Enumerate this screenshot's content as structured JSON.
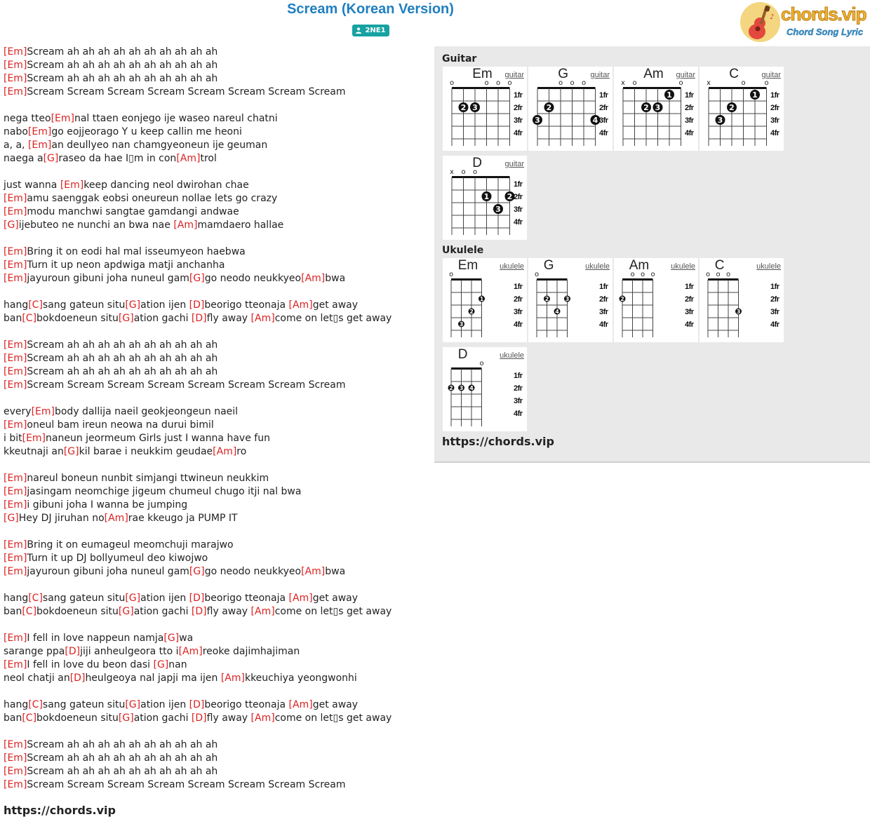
{
  "song": {
    "title": "Scream (Korean Version)",
    "artist": "2NE1"
  },
  "logo": {
    "wordmark": "chords.vip",
    "tagline": "Chord Song Lyric",
    "icon": "ukulele-icon"
  },
  "colors": {
    "title": "#1f7fc1",
    "chord": "#dd2222",
    "artist_badge": "#17a2a2"
  },
  "lyrics": [
    [
      [
        "Em",
        ""
      ],
      [
        "",
        "Scream ah ah ah ah ah ah ah ah ah ah"
      ]
    ],
    [
      [
        "Em",
        ""
      ],
      [
        "",
        "Scream ah ah ah ah ah ah ah ah ah ah"
      ]
    ],
    [
      [
        "Em",
        ""
      ],
      [
        "",
        "Scream ah ah ah ah ah ah ah ah ah ah"
      ]
    ],
    [
      [
        "Em",
        ""
      ],
      [
        "",
        "Scream Scream Scream Scream Scream Scream Scream Scream"
      ]
    ],
    [],
    [
      [
        "",
        "nega tteo"
      ],
      [
        "Em",
        ""
      ],
      [
        "",
        "nal ttaen eonjego ije waseo nareul chatni"
      ]
    ],
    [
      [
        "",
        "nabo"
      ],
      [
        "Em",
        ""
      ],
      [
        "",
        "go eojjeorago Y u keep callin me heoni"
      ]
    ],
    [
      [
        "",
        "a, a, "
      ],
      [
        "Em",
        ""
      ],
      [
        "",
        "an deullyeo nan chamgyeoneun ije geuman"
      ]
    ],
    [
      [
        "",
        "naega a"
      ],
      [
        "G",
        ""
      ],
      [
        "",
        "raseo da hae I▯m in con"
      ],
      [
        "Am",
        ""
      ],
      [
        "",
        "trol"
      ]
    ],
    [],
    [
      [
        "",
        "just wanna "
      ],
      [
        "Em",
        ""
      ],
      [
        "",
        "keep dancing neol dwirohan chae"
      ]
    ],
    [
      [
        "Em",
        ""
      ],
      [
        "",
        "amu saenggak eobsi oneureun nollae lets go crazy"
      ]
    ],
    [
      [
        "Em",
        ""
      ],
      [
        "",
        "modu manchwi sangtae gamdangi andwae"
      ]
    ],
    [
      [
        "G",
        ""
      ],
      [
        "",
        "ijebuteo ne nunchi an bwa nae "
      ],
      [
        "Am",
        ""
      ],
      [
        "",
        "mamdaero hallae"
      ]
    ],
    [],
    [
      [
        "Em",
        ""
      ],
      [
        "",
        "Bring it on eodi hal mal isseumyeon haebwa"
      ]
    ],
    [
      [
        "Em",
        ""
      ],
      [
        "",
        "Turn it up neon apdwiga matji anchanha"
      ]
    ],
    [
      [
        "Em",
        ""
      ],
      [
        "",
        "jayuroun gibuni joha nuneul gam"
      ],
      [
        "G",
        ""
      ],
      [
        "",
        "go neodo neukkyeo"
      ],
      [
        "Am",
        ""
      ],
      [
        "",
        "bwa"
      ]
    ],
    [],
    [
      [
        "",
        "hang"
      ],
      [
        "C",
        ""
      ],
      [
        "",
        "sang gateun situ"
      ],
      [
        "G",
        ""
      ],
      [
        "",
        "ation ijen "
      ],
      [
        "D",
        ""
      ],
      [
        "",
        "beorigo tteonaja "
      ],
      [
        "Am",
        ""
      ],
      [
        "",
        "get away"
      ]
    ],
    [
      [
        "",
        "ban"
      ],
      [
        "C",
        ""
      ],
      [
        "",
        "bokdoeneun situ"
      ],
      [
        "G",
        ""
      ],
      [
        "",
        "ation gachi "
      ],
      [
        "D",
        ""
      ],
      [
        "",
        "fly away "
      ],
      [
        "Am",
        ""
      ],
      [
        "",
        "come on let▯s get away"
      ]
    ],
    [],
    [
      [
        "Em",
        ""
      ],
      [
        "",
        "Scream ah ah ah ah ah ah ah ah ah ah"
      ]
    ],
    [
      [
        "Em",
        ""
      ],
      [
        "",
        "Scream ah ah ah ah ah ah ah ah ah ah"
      ]
    ],
    [
      [
        "Em",
        ""
      ],
      [
        "",
        "Scream ah ah ah ah ah ah ah ah ah ah"
      ]
    ],
    [
      [
        "Em",
        ""
      ],
      [
        "",
        "Scream Scream Scream Scream Scream Scream Scream Scream"
      ]
    ],
    [],
    [
      [
        "",
        "every"
      ],
      [
        "Em",
        ""
      ],
      [
        "",
        "body dallija naeil geokjeongeun naeil"
      ]
    ],
    [
      [
        "Em",
        ""
      ],
      [
        "",
        "oneul bam ireun neowa na durui bimil"
      ]
    ],
    [
      [
        "",
        "i bit"
      ],
      [
        "Em",
        ""
      ],
      [
        "",
        "naneun jeormeum Girls just I wanna have fun"
      ]
    ],
    [
      [
        "",
        "kkeutnaji an"
      ],
      [
        "G",
        ""
      ],
      [
        "",
        "kil barae i neukkim geudae"
      ],
      [
        "Am",
        ""
      ],
      [
        "",
        "ro"
      ]
    ],
    [],
    [
      [
        "Em",
        ""
      ],
      [
        "",
        "nareul boneun nunbit simjangi ttwineun neukkim"
      ]
    ],
    [
      [
        "Em",
        ""
      ],
      [
        "",
        "jasingam neomchige jigeum chumeul chugo itji nal bwa"
      ]
    ],
    [
      [
        "Em",
        ""
      ],
      [
        "",
        "i gibuni joha I wanna be jumping"
      ]
    ],
    [
      [
        "G",
        ""
      ],
      [
        "",
        "Hey DJ jiruhan no"
      ],
      [
        "Am",
        ""
      ],
      [
        "",
        "rae kkeugo ja PUMP IT"
      ]
    ],
    [],
    [
      [
        "Em",
        ""
      ],
      [
        "",
        "Bring it on eumageul meomchuji marajwo"
      ]
    ],
    [
      [
        "Em",
        ""
      ],
      [
        "",
        "Turn it up DJ bollyumeul deo kiwojwo"
      ]
    ],
    [
      [
        "Em",
        ""
      ],
      [
        "",
        "jayuroun gibuni joha nuneul gam"
      ],
      [
        "G",
        ""
      ],
      [
        "",
        "go neodo neukkyeo"
      ],
      [
        "Am",
        ""
      ],
      [
        "",
        "bwa"
      ]
    ],
    [],
    [
      [
        "",
        "hang"
      ],
      [
        "C",
        ""
      ],
      [
        "",
        "sang gateun situ"
      ],
      [
        "G",
        ""
      ],
      [
        "",
        "ation ijen "
      ],
      [
        "D",
        ""
      ],
      [
        "",
        "beorigo tteonaja "
      ],
      [
        "Am",
        ""
      ],
      [
        "",
        "get away"
      ]
    ],
    [
      [
        "",
        "ban"
      ],
      [
        "C",
        ""
      ],
      [
        "",
        "bokdoeneun situ"
      ],
      [
        "G",
        ""
      ],
      [
        "",
        "ation gachi "
      ],
      [
        "D",
        ""
      ],
      [
        "",
        "fly away "
      ],
      [
        "Am",
        ""
      ],
      [
        "",
        "come on let▯s get away"
      ]
    ],
    [],
    [
      [
        "Em",
        ""
      ],
      [
        "",
        "I fell in love nappeun namja"
      ],
      [
        "G",
        ""
      ],
      [
        "",
        "wa"
      ]
    ],
    [
      [
        "",
        "sarange ppa"
      ],
      [
        "D",
        ""
      ],
      [
        "",
        "jiji anheulgeora tto i"
      ],
      [
        "Am",
        ""
      ],
      [
        "",
        "reoke dajimhajiman"
      ]
    ],
    [
      [
        "Em",
        ""
      ],
      [
        "",
        "I fell in love du beon dasi "
      ],
      [
        "G",
        ""
      ],
      [
        "",
        "nan"
      ]
    ],
    [
      [
        "",
        "neol chatji an"
      ],
      [
        "D",
        ""
      ],
      [
        "",
        "heulgeoya nal japji ma ijen "
      ],
      [
        "Am",
        ""
      ],
      [
        "",
        "kkeuchiya yeongwonhi"
      ]
    ],
    [],
    [
      [
        "",
        "hang"
      ],
      [
        "C",
        ""
      ],
      [
        "",
        "sang gateun situ"
      ],
      [
        "G",
        ""
      ],
      [
        "",
        "ation ijen "
      ],
      [
        "D",
        ""
      ],
      [
        "",
        "beorigo tteonaja "
      ],
      [
        "Am",
        ""
      ],
      [
        "",
        "get away"
      ]
    ],
    [
      [
        "",
        "ban"
      ],
      [
        "C",
        ""
      ],
      [
        "",
        "bokdoeneun situ"
      ],
      [
        "G",
        ""
      ],
      [
        "",
        "ation gachi "
      ],
      [
        "D",
        ""
      ],
      [
        "",
        "fly away "
      ],
      [
        "Am",
        ""
      ],
      [
        "",
        "come on let▯s get away"
      ]
    ],
    [],
    [
      [
        "Em",
        ""
      ],
      [
        "",
        "Scream ah ah ah ah ah ah ah ah ah ah"
      ]
    ],
    [
      [
        "Em",
        ""
      ],
      [
        "",
        "Scream ah ah ah ah ah ah ah ah ah ah"
      ]
    ],
    [
      [
        "Em",
        ""
      ],
      [
        "",
        "Scream ah ah ah ah ah ah ah ah ah ah"
      ]
    ],
    [
      [
        "Em",
        ""
      ],
      [
        "",
        "Scream Scream Scream Scream Scream Scream Scream Scream"
      ]
    ]
  ],
  "footer_url": "https://chords.vip",
  "panel": {
    "guitar_label": "Guitar",
    "ukulele_label": "Ukulele",
    "url": "https://chords.vip",
    "fret_labels": [
      "1fr",
      "2fr",
      "3fr",
      "4fr"
    ],
    "guitar": [
      {
        "name": "Em",
        "inst": "guitar",
        "top": [
          "o",
          "",
          "",
          "o",
          "o",
          "o"
        ],
        "dots": [
          [
            1,
            2,
            "2"
          ],
          [
            2,
            2,
            "3"
          ]
        ]
      },
      {
        "name": "G",
        "inst": "guitar",
        "top": [
          "",
          "",
          "o",
          "o",
          "o",
          ""
        ],
        "dots": [
          [
            0,
            3,
            "3"
          ],
          [
            1,
            2,
            "2"
          ],
          [
            5,
            3,
            "4"
          ]
        ]
      },
      {
        "name": "Am",
        "inst": "guitar",
        "top": [
          "x",
          "o",
          "",
          "",
          "",
          "o"
        ],
        "dots": [
          [
            2,
            2,
            "2"
          ],
          [
            3,
            2,
            "3"
          ],
          [
            4,
            1,
            "1"
          ]
        ]
      },
      {
        "name": "C",
        "inst": "guitar",
        "top": [
          "x",
          "",
          "",
          "o",
          "",
          "o"
        ],
        "dots": [
          [
            1,
            3,
            "3"
          ],
          [
            2,
            2,
            "2"
          ],
          [
            4,
            1,
            "1"
          ]
        ]
      },
      {
        "name": "D",
        "inst": "guitar",
        "top": [
          "x",
          "o",
          "o",
          "",
          "",
          ""
        ],
        "dots": [
          [
            3,
            2,
            "1"
          ],
          [
            4,
            3,
            "3"
          ],
          [
            5,
            2,
            "2"
          ]
        ]
      }
    ],
    "ukulele": [
      {
        "name": "Em",
        "inst": "ukulele",
        "top": [
          "o",
          "",
          "",
          ""
        ],
        "dots": [
          [
            1,
            4,
            "3"
          ],
          [
            2,
            3,
            "2"
          ],
          [
            3,
            2,
            "1"
          ]
        ]
      },
      {
        "name": "G",
        "inst": "ukulele",
        "top": [
          "o",
          "",
          "",
          ""
        ],
        "dots": [
          [
            1,
            2,
            "2"
          ],
          [
            2,
            3,
            "4"
          ],
          [
            3,
            2,
            "3"
          ]
        ]
      },
      {
        "name": "Am",
        "inst": "ukulele",
        "top": [
          "",
          "o",
          "o",
          "o"
        ],
        "dots": [
          [
            0,
            2,
            "2"
          ]
        ]
      },
      {
        "name": "C",
        "inst": "ukulele",
        "top": [
          "o",
          "o",
          "o",
          ""
        ],
        "dots": [
          [
            3,
            3,
            "3"
          ]
        ]
      },
      {
        "name": "D",
        "inst": "ukulele",
        "top": [
          "",
          "",
          "",
          "o"
        ],
        "dots": [
          [
            0,
            2,
            "2"
          ],
          [
            1,
            2,
            "3"
          ],
          [
            2,
            2,
            "4"
          ]
        ]
      }
    ]
  }
}
